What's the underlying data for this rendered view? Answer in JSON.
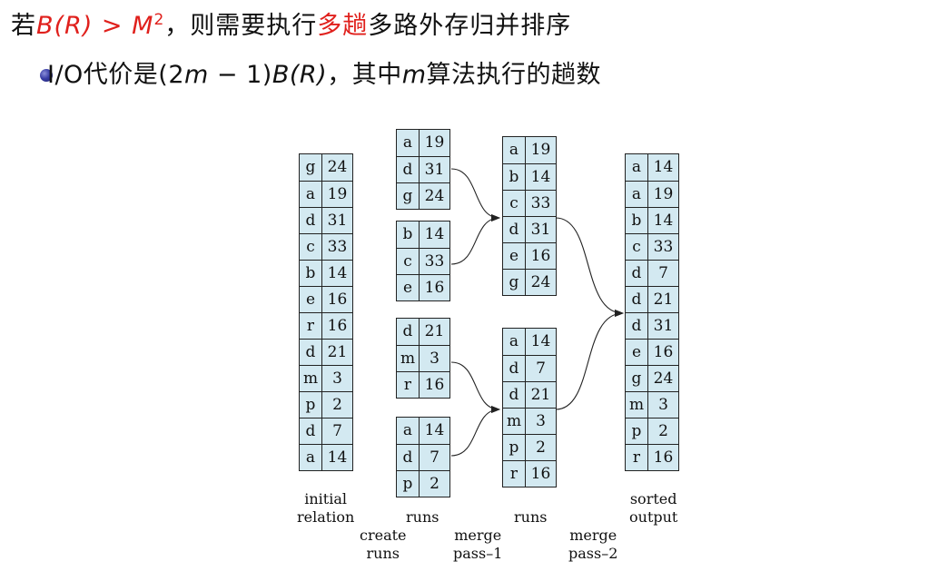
{
  "heading": {
    "prefix": "若",
    "condition": "B(R) > M",
    "exponent": "2",
    "mid": "，则需要执行",
    "highlight": "多趟",
    "suffix": "多路外存归并排序"
  },
  "bullet": {
    "prefix": "I/O代价是(2",
    "m1": "m",
    "minus": " − 1)",
    "br": "B(R)",
    "mid": "，其中",
    "m2": "m",
    "suffix": "算法执行的趟数"
  },
  "diagram": {
    "initial_relation": [
      [
        "g",
        "24"
      ],
      [
        "a",
        "19"
      ],
      [
        "d",
        "31"
      ],
      [
        "c",
        "33"
      ],
      [
        "b",
        "14"
      ],
      [
        "e",
        "16"
      ],
      [
        "r",
        "16"
      ],
      [
        "d",
        "21"
      ],
      [
        "m",
        "3"
      ],
      [
        "p",
        "2"
      ],
      [
        "d",
        "7"
      ],
      [
        "a",
        "14"
      ]
    ],
    "runs_1": [
      [
        [
          "a",
          "19"
        ],
        [
          "d",
          "31"
        ],
        [
          "g",
          "24"
        ]
      ],
      [
        [
          "b",
          "14"
        ],
        [
          "c",
          "33"
        ],
        [
          "e",
          "16"
        ]
      ],
      [
        [
          "d",
          "21"
        ],
        [
          "m",
          "3"
        ],
        [
          "r",
          "16"
        ]
      ],
      [
        [
          "a",
          "14"
        ],
        [
          "d",
          "7"
        ],
        [
          "p",
          "2"
        ]
      ]
    ],
    "runs_2": [
      [
        [
          "a",
          "19"
        ],
        [
          "b",
          "14"
        ],
        [
          "c",
          "33"
        ],
        [
          "d",
          "31"
        ],
        [
          "e",
          "16"
        ],
        [
          "g",
          "24"
        ]
      ],
      [
        [
          "a",
          "14"
        ],
        [
          "d",
          "7"
        ],
        [
          "d",
          "21"
        ],
        [
          "m",
          "3"
        ],
        [
          "p",
          "2"
        ],
        [
          "r",
          "16"
        ]
      ]
    ],
    "sorted_output": [
      [
        "a",
        "14"
      ],
      [
        "a",
        "19"
      ],
      [
        "b",
        "14"
      ],
      [
        "c",
        "33"
      ],
      [
        "d",
        "7"
      ],
      [
        "d",
        "21"
      ],
      [
        "d",
        "31"
      ],
      [
        "e",
        "16"
      ],
      [
        "g",
        "24"
      ],
      [
        "m",
        "3"
      ],
      [
        "p",
        "2"
      ],
      [
        "r",
        "16"
      ]
    ],
    "labels": {
      "initial_relation": [
        "initial",
        "relation"
      ],
      "create_runs": [
        "create",
        "runs"
      ],
      "runs_a": "runs",
      "merge_pass_1": [
        "merge",
        "pass–1"
      ],
      "runs_b": "runs",
      "merge_pass_2": [
        "merge",
        "pass–2"
      ],
      "sorted_output": [
        "sorted",
        "output"
      ]
    }
  }
}
